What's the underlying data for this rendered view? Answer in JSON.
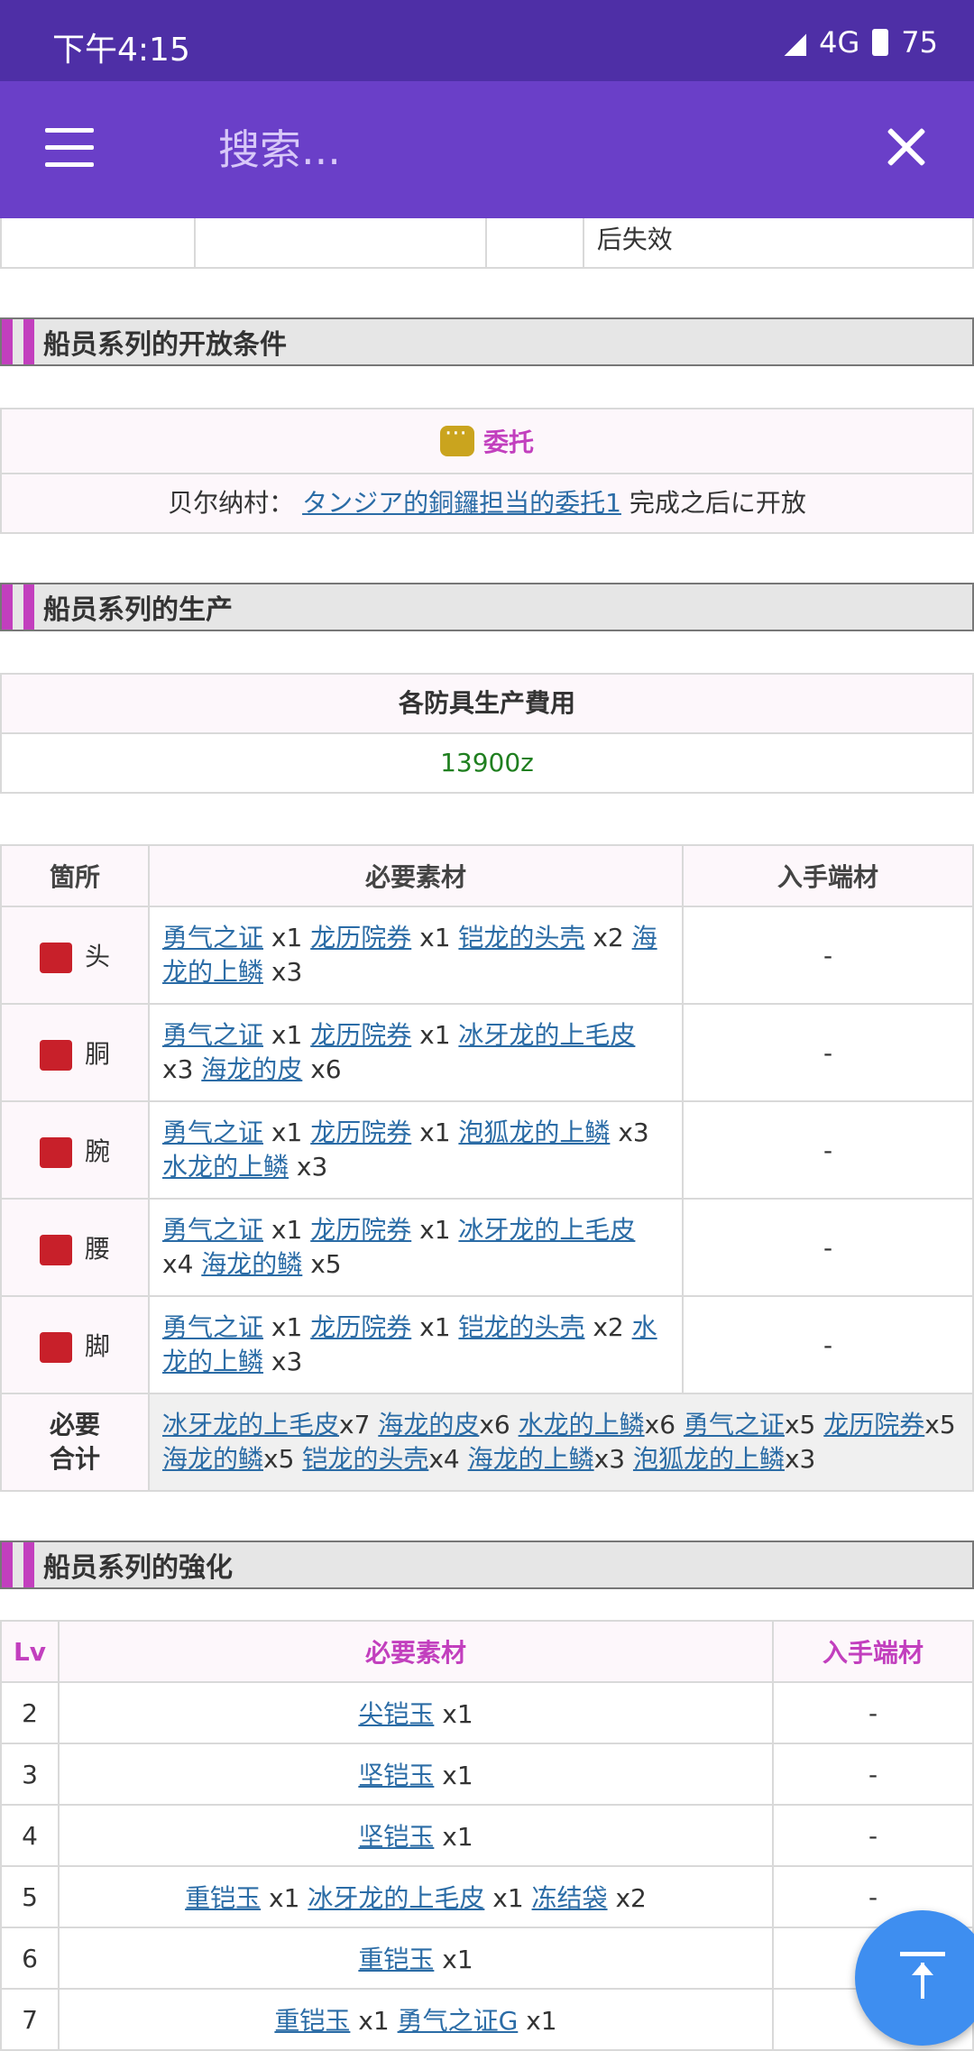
{
  "status": {
    "time": "下午4:15",
    "network": "4G",
    "battery": "75"
  },
  "search": {
    "placeholder": "搜索..."
  },
  "top_row": {
    "text": "后失效"
  },
  "sections": {
    "open_conditions": "船员系列的开放条件",
    "production": "船员系列的生产",
    "enhancement": "船员系列的強化"
  },
  "commission": {
    "label": "委托",
    "prefix": "贝尔纳村：",
    "link": "タンジア的銅鑼担当的委托1",
    "suffix": "完成之后に开放"
  },
  "cost": {
    "title": "各防具生产費用",
    "value": "13900z"
  },
  "materials": {
    "headers": [
      "箇所",
      "必要素材",
      "入手端材"
    ],
    "rows": [
      {
        "part": "头",
        "items": [
          [
            "勇气之证",
            "x1"
          ],
          [
            "龙历院券",
            "x1"
          ],
          [
            "铠龙的头壳",
            "x2"
          ],
          [
            "海龙的上鳞",
            "x3"
          ]
        ],
        "src": "-"
      },
      {
        "part": "胴",
        "items": [
          [
            "勇气之证",
            "x1"
          ],
          [
            "龙历院券",
            "x1"
          ],
          [
            "冰牙龙的上毛皮",
            "x3"
          ],
          [
            "海龙的皮",
            "x6"
          ]
        ],
        "src": "-"
      },
      {
        "part": "腕",
        "items": [
          [
            "勇气之证",
            "x1"
          ],
          [
            "龙历院券",
            "x1"
          ],
          [
            "泡狐龙的上鳞",
            "x3"
          ],
          [
            "水龙的上鳞",
            "x3"
          ]
        ],
        "src": "-"
      },
      {
        "part": "腰",
        "items": [
          [
            "勇气之证",
            "x1"
          ],
          [
            "龙历院券",
            "x1"
          ],
          [
            "冰牙龙的上毛皮",
            "x4"
          ],
          [
            "海龙的鳞",
            "x5"
          ]
        ],
        "src": "-"
      },
      {
        "part": "脚",
        "items": [
          [
            "勇气之证",
            "x1"
          ],
          [
            "龙历院券",
            "x1"
          ],
          [
            "铠龙的头壳",
            "x2"
          ],
          [
            "水龙的上鳞",
            "x3"
          ]
        ],
        "src": "-"
      }
    ],
    "total_label": "必要\n合计",
    "total_items": [
      [
        "冰牙龙的上毛皮",
        "x7"
      ],
      [
        "海龙的皮",
        "x6"
      ],
      [
        "水龙的上鳞",
        "x6"
      ],
      [
        "勇气之证",
        "x5"
      ],
      [
        "龙历院券",
        "x5"
      ],
      [
        "海龙的鳞",
        "x5"
      ],
      [
        "铠龙的头壳",
        "x4"
      ],
      [
        "海龙的上鳞",
        "x3"
      ],
      [
        "泡狐龙的上鳞",
        "x3"
      ]
    ]
  },
  "enhance": {
    "headers": [
      "Lv",
      "必要素材",
      "入手端材"
    ],
    "rows": [
      {
        "lv": "2",
        "items": [
          [
            "尖铠玉",
            "x1"
          ]
        ],
        "src": "-"
      },
      {
        "lv": "3",
        "items": [
          [
            "坚铠玉",
            "x1"
          ]
        ],
        "src": "-"
      },
      {
        "lv": "4",
        "items": [
          [
            "坚铠玉",
            "x1"
          ]
        ],
        "src": "-"
      },
      {
        "lv": "5",
        "items": [
          [
            "重铠玉",
            "x1"
          ],
          [
            "冰牙龙的上毛皮",
            "x1"
          ],
          [
            "冻结袋",
            "x2"
          ]
        ],
        "src": "-"
      },
      {
        "lv": "6",
        "items": [
          [
            "重铠玉",
            "x1"
          ]
        ],
        "src": ""
      },
      {
        "lv": "7",
        "items": [
          [
            "重铠玉",
            "x1"
          ],
          [
            "勇气之证G",
            "x1"
          ]
        ],
        "src": ""
      }
    ]
  },
  "colors": {
    "statusbar": "#4e2fa6",
    "appbar": "#6a3fc8",
    "accent": "#c23fbe",
    "link": "#2b6ca6",
    "cost": "#1f7f1f",
    "fab": "#3e8ef0"
  },
  "icons": {
    "menu": "hamburger-icon",
    "close": "close-icon",
    "commission": "chat-bubble-icon",
    "fab": "scroll-to-top-icon"
  }
}
